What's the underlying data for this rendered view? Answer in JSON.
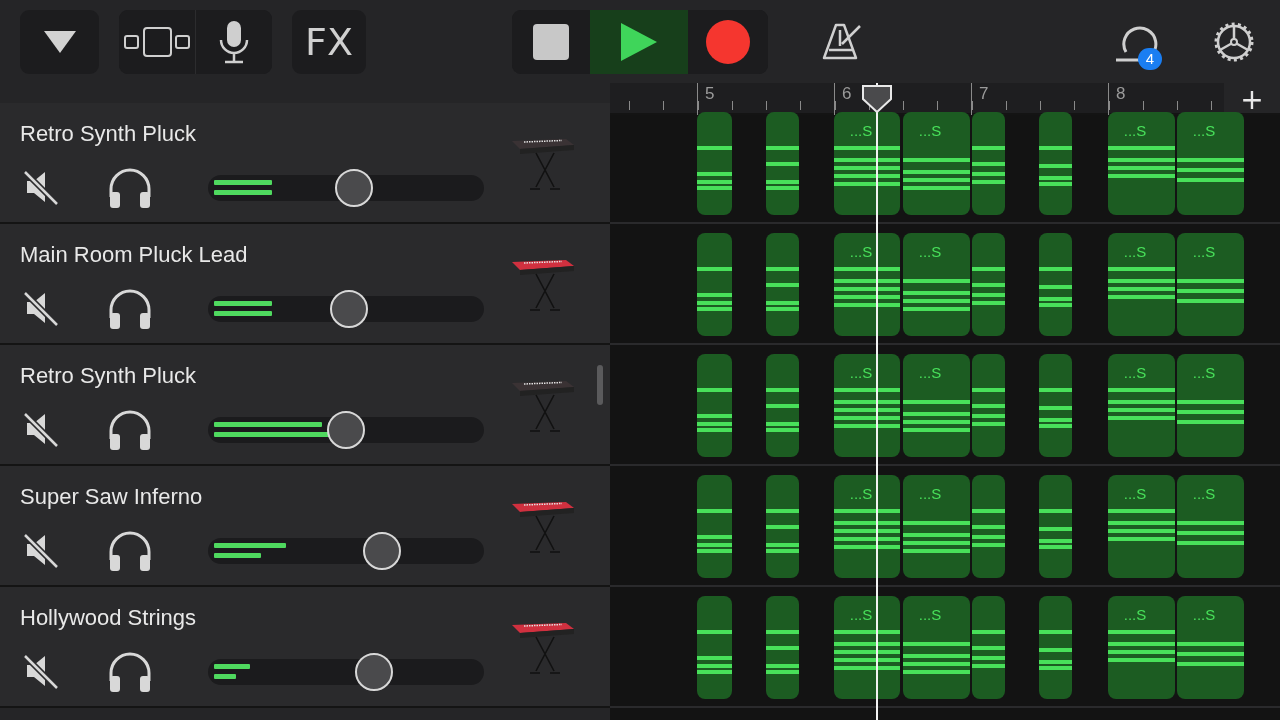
{
  "toolbar": {
    "badge": "4",
    "fx_label": "FX",
    "play_selected": true,
    "record_selected": false,
    "metronome_on": false
  },
  "ruler": {
    "bars": [
      "5",
      "6",
      "7",
      "8"
    ],
    "add_label": "+"
  },
  "tracks": [
    {
      "name": "Retro Synth Pluck",
      "muted": false,
      "solo": false,
      "volume": {
        "level": 0.53
      },
      "meters": [
        {
          "level": 0.21
        },
        {
          "level": 0.21
        }
      ],
      "color": "#3a3234",
      "regions": [
        {
          "kind": "plain"
        },
        {
          "kind": "plain"
        },
        {
          "kind": "named",
          "label": "...S"
        },
        {
          "kind": "named",
          "label": "...S"
        },
        {
          "kind": "plain"
        },
        {
          "kind": "plain"
        },
        {
          "kind": "named",
          "label": "...S"
        },
        {
          "kind": "named",
          "label": "...S"
        }
      ]
    },
    {
      "name": "Main Room Pluck Lead",
      "muted": false,
      "solo": false,
      "volume": {
        "level": 0.51
      },
      "meters": [
        {
          "level": 0.21
        },
        {
          "level": 0.21
        }
      ],
      "color": "#d0303f",
      "regions": [
        {
          "kind": "plain"
        },
        {
          "kind": "plain"
        },
        {
          "kind": "named",
          "label": "...S"
        },
        {
          "kind": "named",
          "label": "...S"
        },
        {
          "kind": "plain"
        },
        {
          "kind": "plain"
        },
        {
          "kind": "named",
          "label": "...S"
        },
        {
          "kind": "named",
          "label": "...S"
        }
      ]
    },
    {
      "name": "Retro Synth Pluck",
      "muted": false,
      "solo": false,
      "volume": {
        "level": 0.5
      },
      "meters": [
        {
          "level": 0.39
        },
        {
          "level": 0.43
        }
      ],
      "color": "#3a3234",
      "regions": [
        {
          "kind": "plain"
        },
        {
          "kind": "plain"
        },
        {
          "kind": "named",
          "label": "...S"
        },
        {
          "kind": "named",
          "label": "...S"
        },
        {
          "kind": "plain"
        },
        {
          "kind": "plain"
        },
        {
          "kind": "named",
          "label": "...S"
        },
        {
          "kind": "named",
          "label": "...S"
        }
      ]
    },
    {
      "name": "Super Saw Inferno",
      "muted": false,
      "solo": false,
      "volume": {
        "level": 0.63
      },
      "meters": [
        {
          "level": 0.26
        },
        {
          "level": 0.17
        }
      ],
      "color": "#d0303f",
      "regions": [
        {
          "kind": "plain"
        },
        {
          "kind": "plain"
        },
        {
          "kind": "named",
          "label": "...S"
        },
        {
          "kind": "named",
          "label": "...S"
        },
        {
          "kind": "plain"
        },
        {
          "kind": "plain"
        },
        {
          "kind": "named",
          "label": "...S"
        },
        {
          "kind": "named",
          "label": "...S"
        }
      ]
    },
    {
      "name": "Hollywood Strings",
      "muted": false,
      "solo": false,
      "volume": {
        "level": 0.6
      },
      "meters": [
        {
          "level": 0.13
        },
        {
          "level": 0.08
        }
      ],
      "color": "#d0303f",
      "regions": [
        {
          "kind": "plain"
        },
        {
          "kind": "plain"
        },
        {
          "kind": "named",
          "label": "...S"
        },
        {
          "kind": "named",
          "label": "...S"
        },
        {
          "kind": "plain"
        },
        {
          "kind": "plain"
        },
        {
          "kind": "named",
          "label": "...S"
        },
        {
          "kind": "named",
          "label": "...S"
        }
      ]
    }
  ]
}
